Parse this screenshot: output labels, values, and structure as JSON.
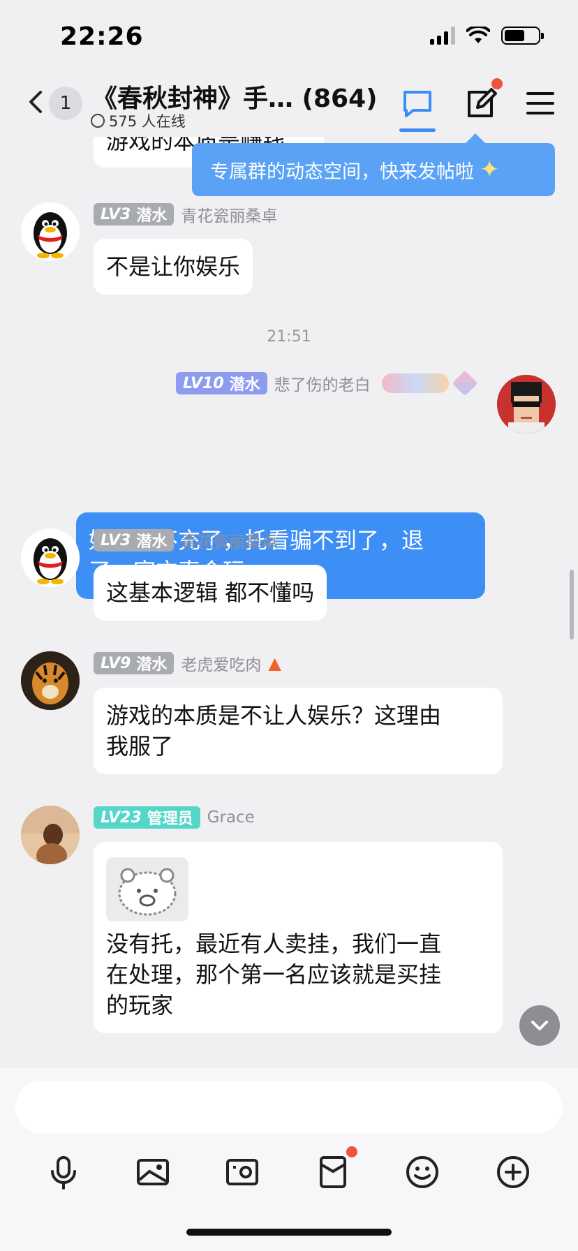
{
  "status_bar": {
    "time": "22:26"
  },
  "header": {
    "unread_count": "1",
    "title": "《春秋封神》手…  (864)",
    "online": "575 人在线"
  },
  "tooltip": {
    "text": "专属群的动态空间，快来发帖啦"
  },
  "partial_top_message": {
    "text": "游戏的本质是赚钱"
  },
  "messages": [
    {
      "level": "LV3",
      "role": "潜水",
      "name": "青花瓷丽桑卓",
      "text": "不是让你娱乐"
    },
    {
      "timestamp": "21:51"
    },
    {
      "level": "LV10",
      "role": "潜水",
      "name": "悲了伤的老白",
      "line1": "好几天不充了，托看骗不到了，退",
      "line2": "了，官方真会玩"
    },
    {
      "level": "LV3",
      "role": "潜水",
      "name": "青花瓷丽桑卓",
      "text": "这基本逻辑 都不懂吗"
    },
    {
      "level": "LV9",
      "role": "潜水",
      "name": "老虎爱吃肉",
      "line1": "游戏的本质是不让人娱乐？这理由",
      "line2": "我服了"
    },
    {
      "level": "LV23",
      "role": "管理员",
      "name": "Grace",
      "line1": "没有托，最近有人卖挂，我们一直",
      "line2": "在处理，那个第一名应该就是买挂",
      "line3": "的玩家"
    }
  ],
  "colors": {
    "accent": "#3d8ef5",
    "tooltip": "#5aa2f6",
    "badge_dot": "#f0523d"
  },
  "toolbar_icons": [
    "microphone-icon",
    "image-icon",
    "camera-icon",
    "red-packet-icon",
    "emoji-icon",
    "plus-icon"
  ]
}
